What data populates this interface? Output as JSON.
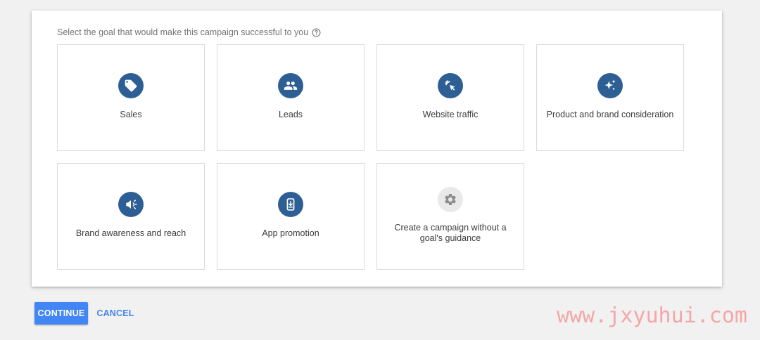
{
  "prompt": {
    "text": "Select the goal that would make this campaign successful to you",
    "icon": "help-circle-icon"
  },
  "goals": [
    {
      "label": "Sales",
      "icon": "tag-icon"
    },
    {
      "label": "Leads",
      "icon": "people-icon"
    },
    {
      "label": "Website traffic",
      "icon": "cursor-click-icon"
    },
    {
      "label": "Product and brand consideration",
      "icon": "sparkle-icon"
    },
    {
      "label": "Brand awareness and reach",
      "icon": "megaphone-icon"
    },
    {
      "label": "App promotion",
      "icon": "phone-download-icon"
    },
    {
      "label": "Create a campaign without a goal's guidance",
      "icon": "gear-icon"
    }
  ],
  "actions": {
    "continue_label": "CONTINUE",
    "cancel_label": "CANCEL"
  },
  "watermark": "www.jxyuhui.com",
  "colors": {
    "icon_bg": "#2e5f94",
    "icon_bg_neutral": "#e9e9e9",
    "primary": "#4285f4",
    "watermark": "#f3a7a7"
  }
}
